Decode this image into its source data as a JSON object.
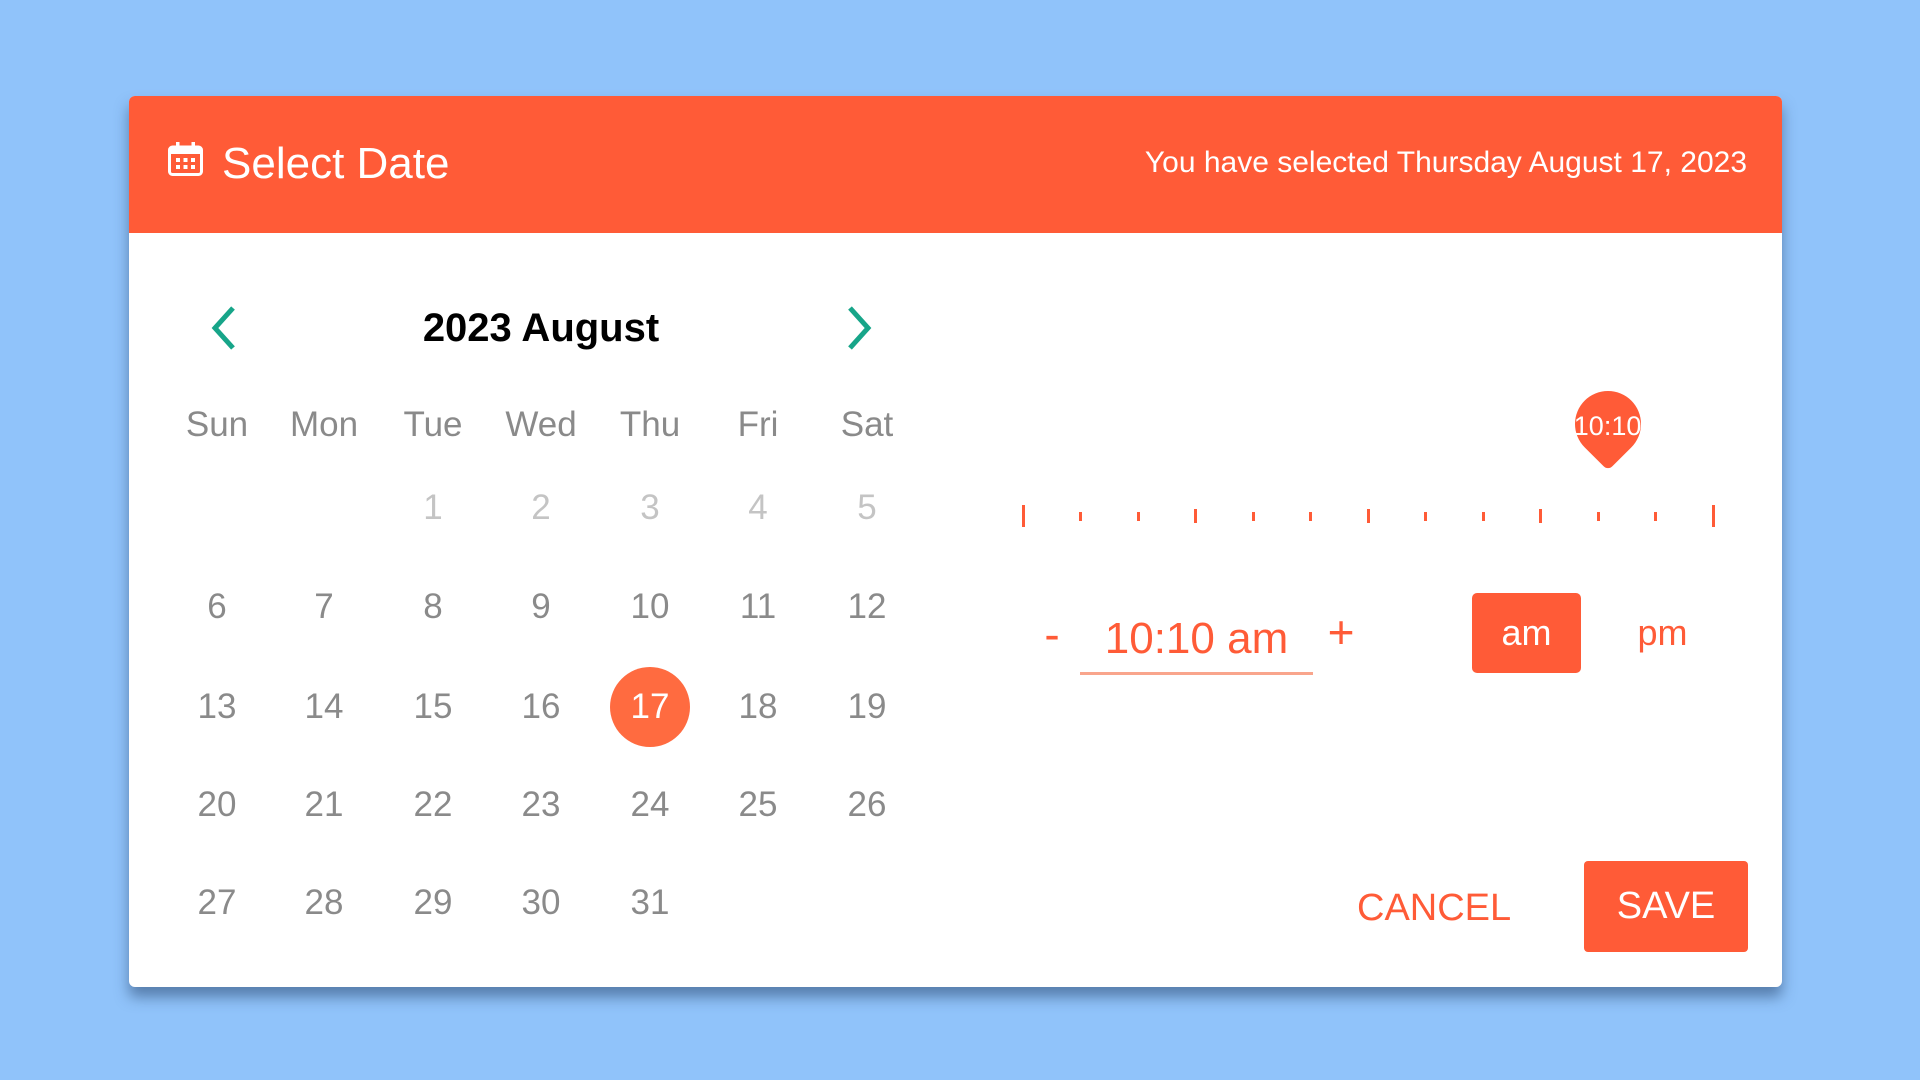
{
  "colors": {
    "accent": "#FF5B37",
    "selected_day": "#FF6B40",
    "nav_arrows": "#17A589",
    "background": "#90C3FA"
  },
  "header": {
    "icon": "calendar-icon",
    "title": "Select Date",
    "summary": "You have selected Thursday August 17, 2023"
  },
  "calendar": {
    "month_title": "2023 August",
    "prev_icon": "chevron-left-icon",
    "next_icon": "chevron-right-icon",
    "weekdays": [
      "Sun",
      "Mon",
      "Tue",
      "Wed",
      "Thu",
      "Fri",
      "Sat"
    ],
    "weeks": [
      [
        null,
        null,
        "1",
        "2",
        "3",
        "4",
        "5"
      ],
      [
        "6",
        "7",
        "8",
        "9",
        "10",
        "11",
        "12"
      ],
      [
        "13",
        "14",
        "15",
        "16",
        "17",
        "18",
        "19"
      ],
      [
        "20",
        "21",
        "22",
        "23",
        "24",
        "25",
        "26"
      ],
      [
        "27",
        "28",
        "29",
        "30",
        "31",
        null,
        null
      ]
    ],
    "muted_days": [
      "1",
      "2",
      "3",
      "4",
      "5"
    ],
    "selected_day": "17"
  },
  "time": {
    "slider_label": "10:10",
    "slider_value_hours": 10.1667,
    "slider_min_hours": 0,
    "slider_max_hours": 12,
    "tick_count": 13,
    "decrement_label": "-",
    "increment_label": "+",
    "value": "10:10 am",
    "am_label": "am",
    "pm_label": "pm",
    "period": "am"
  },
  "actions": {
    "cancel_label": "CANCEL",
    "save_label": "SAVE"
  }
}
